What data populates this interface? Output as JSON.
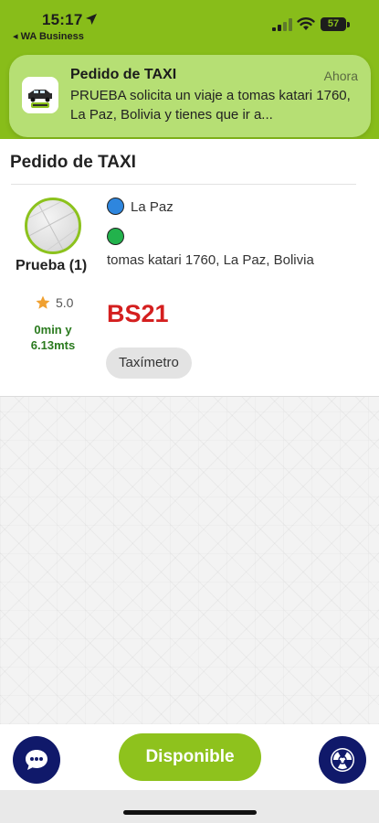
{
  "status_bar": {
    "time": "15:17",
    "back_app": "◂ WA Business",
    "battery": "57"
  },
  "notification": {
    "app_icon": "taxi-app-icon",
    "title": "Pedido de TAXI",
    "time": "Ahora",
    "body": "PRUEBA solicita un viaje a tomas katari 1760, La Paz, Bolivia y tienes que ir a..."
  },
  "order": {
    "title": "Pedido de TAXI",
    "rider": {
      "name": "Prueba (1)",
      "rating": "5.0",
      "eta": "0min y 6.13mts"
    },
    "origin": "La Paz",
    "destination": "tomas katari 1760, La Paz, Bolivia",
    "price": "BS21",
    "meter_label": "Taxímetro"
  },
  "bottom_bar": {
    "available_label": "Disponible",
    "chat_icon": "chat-icon",
    "radio_icon": "radiation-icon"
  },
  "colors": {
    "brand_green": "#88bd1a",
    "navy": "#10196a",
    "price_red": "#d41f1f"
  }
}
